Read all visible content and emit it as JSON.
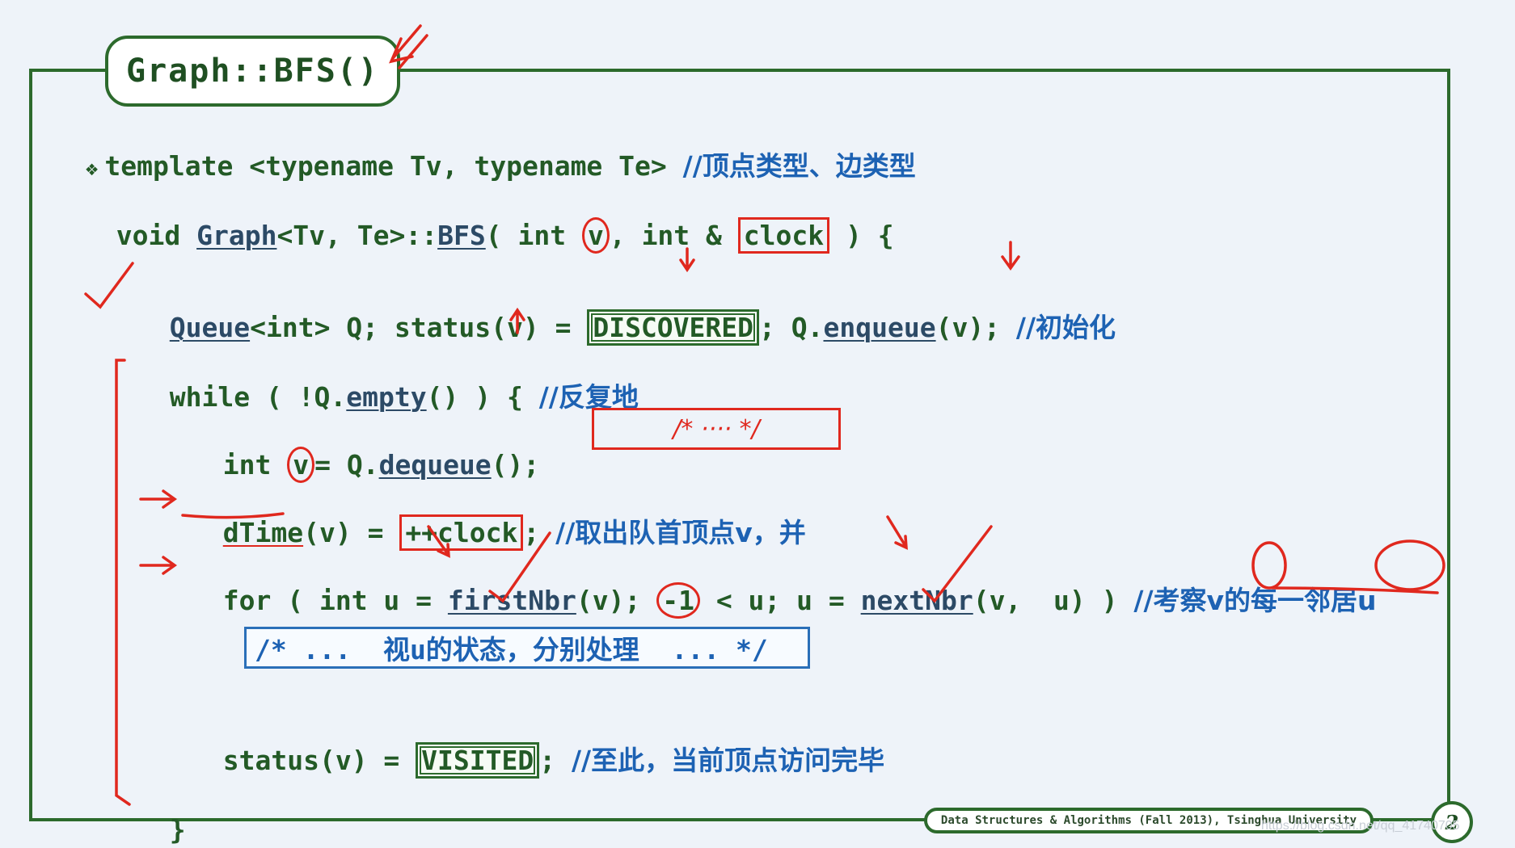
{
  "slide": {
    "title": "Graph::BFS()",
    "footer": "Data Structures & Algorithms (Fall 2013), Tsinghua University",
    "page_number": "2",
    "watermark": "https://blog.csdn.net/qq_41740705"
  },
  "code": {
    "line1": {
      "bullet": "❖",
      "code": "template <typename Tv, typename Te> ",
      "comment": "//顶点类型、边类型"
    },
    "line2": {
      "pre": "void ",
      "fn1": "Graph",
      "mid": "<Tv, Te>::",
      "fn2": "BFS",
      "a": "( int ",
      "v": "v",
      "b": ", int & ",
      "clock": "clock",
      "c": " ) {"
    },
    "line3": {
      "fn1": "Queue",
      "a": "<int> Q; status(v) = ",
      "discovered": "DISCOVERED",
      "b": "; Q.",
      "fn2": "enqueue",
      "c": "(v); ",
      "comment": "//初始化"
    },
    "line4": {
      "a": "while ( !Q.",
      "fn": "empty",
      "b": "() ) { ",
      "comment": "//反复地"
    },
    "line5": {
      "a": "int ",
      "v": "v",
      "b": "= Q.",
      "fn": "dequeue",
      "c": "();"
    },
    "line6": {
      "fn": "dTime",
      "a": "(v) = ",
      "clock": "++clock",
      "b": "; ",
      "comment": "//取出队首顶点v，并"
    },
    "line7": {
      "a": "for ( int u = ",
      "fn1": "firstNbr",
      "b": "(v); ",
      "neg": "-1",
      "c": " < u; u = ",
      "fn2": "nextNbr",
      "d": "(v,  u) ) ",
      "comment": "//考察v的每一邻居u"
    },
    "line8": {
      "comment": "/* ...  视u的状态，分别处理  ... */"
    },
    "line9": {
      "a": "status(v) = ",
      "visited": "VISITED",
      "b": "; ",
      "comment": "//至此，当前顶点访问完毕"
    },
    "line10": {
      "a": "}"
    }
  },
  "annotations": {
    "handwritten_note": "/* ···· */",
    "ink_color": "#e0281e"
  },
  "colors": {
    "code_green": "#235a26",
    "comment_blue": "#1d62b3",
    "frame_green": "#2c6a2c",
    "background": "#eef3f9"
  }
}
